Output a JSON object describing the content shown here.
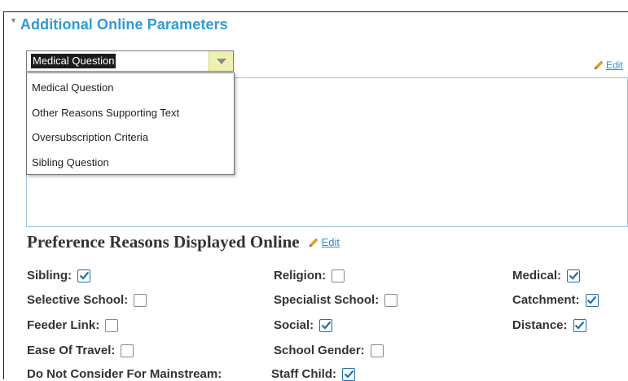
{
  "section": {
    "title": "Additional Online Parameters",
    "collapse_glyph": "▼"
  },
  "select": {
    "value": "Medical Question",
    "options": [
      "Medical Question",
      "Other Reasons Supporting Text",
      "Oversubscription Criteria",
      "Sibling Question"
    ]
  },
  "edit_link": "Edit",
  "preferences": {
    "title": "Preference Reasons Displayed Online",
    "edit_label": "Edit",
    "items": [
      {
        "label": "Sibling:",
        "checked": true
      },
      {
        "label": "Religion:",
        "checked": false
      },
      {
        "label": "Medical:",
        "checked": true
      },
      {
        "label": "Selective School:",
        "checked": false
      },
      {
        "label": "Specialist School:",
        "checked": false
      },
      {
        "label": "Catchment:",
        "checked": true
      },
      {
        "label": "Feeder Link:",
        "checked": false
      },
      {
        "label": "Social:",
        "checked": true
      },
      {
        "label": "Distance:",
        "checked": true
      },
      {
        "label": "Ease Of Travel:",
        "checked": false
      },
      {
        "label": "School Gender:",
        "checked": false
      },
      {
        "label": "Do Not Consider For Mainstream:",
        "checked": null
      },
      {
        "label": "Staff Child:",
        "checked": true
      }
    ]
  },
  "colors": {
    "accent": "#2e9bd6",
    "link": "#2e8ed0",
    "checkbox_checked": "#1f6fb3",
    "select_button": "#eef1ae"
  }
}
